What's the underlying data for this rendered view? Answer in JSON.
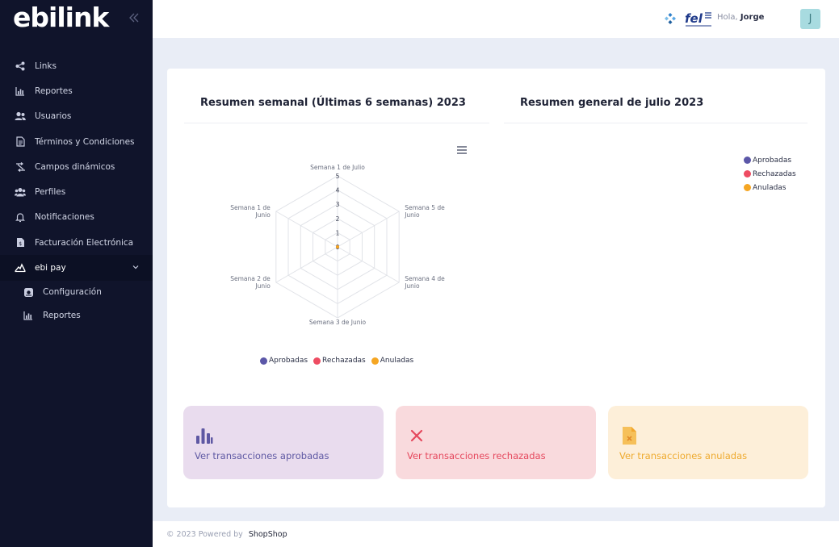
{
  "app": {
    "logo_text": "ebilink"
  },
  "sidebar": {
    "items": [
      {
        "label": "Links",
        "icon": "share-icon"
      },
      {
        "label": "Reportes",
        "icon": "bar-chart-icon"
      },
      {
        "label": "Usuarios",
        "icon": "users-icon"
      },
      {
        "label": "Términos y Condiciones",
        "icon": "document-icon"
      },
      {
        "label": "Campos dinámicos",
        "icon": "transform-icon"
      },
      {
        "label": "Perfiles",
        "icon": "group-icon"
      },
      {
        "label": "Notificaciones",
        "icon": "bell-icon"
      },
      {
        "label": "Facturación Electrónica",
        "icon": "invoice-icon"
      },
      {
        "label": "ebi pay",
        "icon": "ebipay-icon",
        "expanded": true
      }
    ],
    "subitems": [
      {
        "label": "Configuración",
        "icon": "settings-icon"
      },
      {
        "label": "Reportes",
        "icon": "bar-chart-icon"
      }
    ]
  },
  "header": {
    "greeting": "Hola,",
    "user_name": "Jorge",
    "avatar_initial": "J",
    "fel_logo_text": "fel"
  },
  "weekly": {
    "title": "Resumen semanal (Últimas 6 semanas) 2023"
  },
  "monthly": {
    "title": "Resumen general de julio 2023"
  },
  "legend": [
    {
      "label": "Aprobadas",
      "color": "#5b57a8"
    },
    {
      "label": "Rechazadas",
      "color": "#ee4c62"
    },
    {
      "label": "Anuladas",
      "color": "#f5a623"
    }
  ],
  "chart_data": {
    "type": "radar",
    "title": "Resumen semanal (Últimas 6 semanas) 2023",
    "categories": [
      "Semana 1 de Julio",
      "Semana 5 de Junio",
      "Semana 4 de Junio",
      "Semana 3 de Junio",
      "Semana 2 de Junio",
      "Semana 1 de Junio"
    ],
    "category_lines": [
      [
        "Semana 1 de Julio"
      ],
      [
        "Semana 5 de",
        "Junio"
      ],
      [
        "Semana 4 de",
        "Junio"
      ],
      [
        "Semana 3 de Junio"
      ],
      [
        "Semana 2 de",
        "Junio"
      ],
      [
        "Semana 1 de",
        "Junio"
      ]
    ],
    "radial_ticks": [
      "0",
      "1",
      "2",
      "3",
      "4",
      "5"
    ],
    "rlim": [
      0,
      5
    ],
    "series": [
      {
        "name": "Aprobadas",
        "values": [
          0,
          0,
          0,
          0,
          0,
          0
        ]
      },
      {
        "name": "Rechazadas",
        "values": [
          0,
          0,
          0,
          0,
          0,
          0
        ]
      },
      {
        "name": "Anuladas",
        "values": [
          0,
          0,
          0,
          0,
          0,
          0
        ]
      }
    ],
    "legend_position": "bottom"
  },
  "tiles": [
    {
      "label": "Ver transacciones aprobadas",
      "icon": "bar-chart-icon"
    },
    {
      "label": "Ver transacciones rechazadas",
      "icon": "close-icon"
    },
    {
      "label": "Ver transacciones anuladas",
      "icon": "cancelled-document-icon"
    }
  ],
  "footer": {
    "text": "© 2023 Powered by",
    "brand": "ShopShop"
  }
}
